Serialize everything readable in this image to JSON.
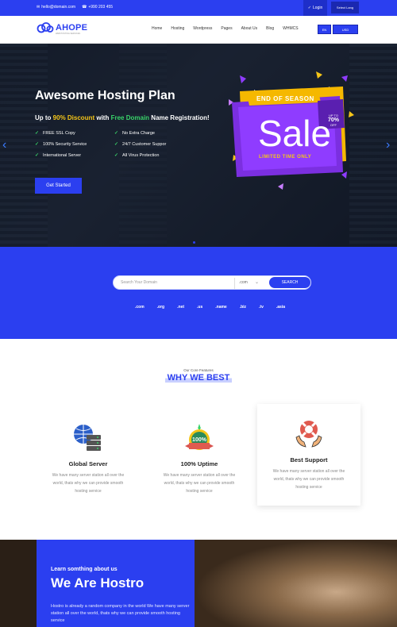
{
  "topbar": {
    "email": "hello@domain.com",
    "phone": "+990 203 455",
    "login_label": "Login",
    "select_label": "Select Lang"
  },
  "header": {
    "logo_name": "AHOPE",
    "logo_tagline": "WEB HOSTING SERVICES",
    "nav": [
      "Home",
      "Hosting",
      "Wordpress",
      "Pages",
      "About Us",
      "Blog",
      "WHMCS"
    ],
    "button_a": "EN",
    "button_b": "USD"
  },
  "hero": {
    "title": "Awesome Hosting Plan",
    "subtitle_pre": "Up to ",
    "subtitle_discount": "90% Discount",
    "subtitle_mid": " with ",
    "subtitle_free": "Free Domain",
    "subtitle_post": " Name Registration!",
    "features": [
      "FREE SSL Copy",
      "No Extra Charge",
      "100% Security Service",
      "24/7 Customer Suppor",
      "International Server",
      "All Virus Protection"
    ],
    "button_label": "Get Started",
    "sale": {
      "top": "END OF SEASON",
      "word": "Sale",
      "bottom": "LIMITED TIME ONLY",
      "badge_line1": "UP TO",
      "badge_line2": "70%",
      "badge_line3": "OFF"
    },
    "accent_color": "#2b3ff0"
  },
  "domain_search": {
    "placeholder": "Search Your Domain",
    "extension": ".com",
    "button_label": "SEARCH",
    "tlds": [
      ".com",
      ".org",
      ".net",
      ".us",
      ".name",
      ".biz",
      ".tv",
      ".asia"
    ]
  },
  "why": {
    "kicker": "Our Core Features",
    "title": "WHY WE BEST",
    "cards": [
      {
        "title": "Global Server",
        "desc": "We have many server station all over the world, thats why we can provide smooth hosting service",
        "icon": "global-server-icon"
      },
      {
        "title": "100% Uptime",
        "desc": "We have many server station all over the world, thats why we can provide smooth hosting service",
        "icon": "uptime-badge-icon"
      },
      {
        "title": "Best Support",
        "desc": "We have many server station all over the world, thats why we can provide smooth hosting service",
        "icon": "support-lifebuoy-icon"
      }
    ]
  },
  "about": {
    "kicker": "Learn somthing about us",
    "title": "We Are Hostro",
    "desc": "Hostro is already a random company in the world We have many server station all over the world, thats why we can provide smooth hosting service"
  }
}
